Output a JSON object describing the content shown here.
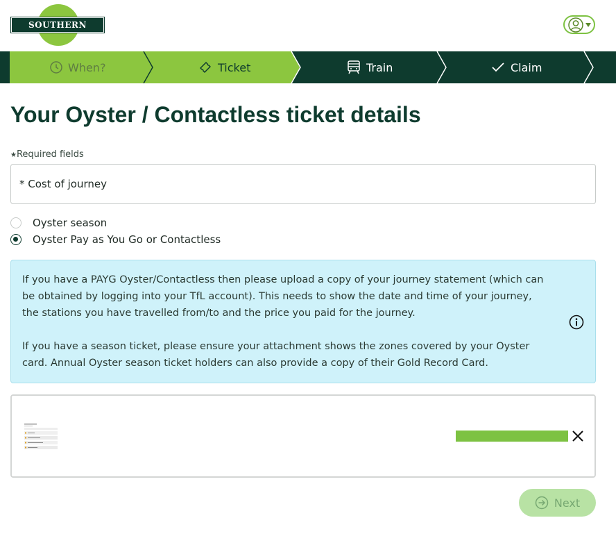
{
  "brand": {
    "logo_text": "SOUTHERN"
  },
  "steps": [
    {
      "label": "When?",
      "icon": "clock-icon",
      "state": "completed"
    },
    {
      "label": "Ticket",
      "icon": "ticket-icon",
      "state": "current"
    },
    {
      "label": "Train",
      "icon": "train-icon",
      "state": "upcoming"
    },
    {
      "label": "Claim",
      "icon": "check-icon",
      "state": "upcoming"
    }
  ],
  "page": {
    "title": "Your Oyster / Contactless ticket details",
    "required_note": "Required fields",
    "required_mark": "★"
  },
  "form": {
    "cost_of_journey": {
      "placeholder": "* Cost of journey",
      "value": ""
    },
    "ticket_type": {
      "options": [
        {
          "label": "Oyster season",
          "checked": false
        },
        {
          "label": "Oyster Pay as You Go or Contactless",
          "checked": true
        }
      ]
    }
  },
  "info": {
    "paragraphs": [
      "If you have a PAYG Oyster/Contactless then please upload a copy of your journey statement (which can be obtained by logging into your TfL account). This needs to show the date and time of your journey, the stations you have travelled from/to and the price you paid for the journey.",
      "If you have a season ticket, please ensure your attachment shows the zones covered by your Oyster card. Annual Oyster season ticket holders can also provide a copy of their Gold Record Card."
    ],
    "icon": "info-icon"
  },
  "upload": {
    "progress": 1.0,
    "remove_icon": "close-icon"
  },
  "actions": {
    "next_label": "Next",
    "next_enabled": false
  },
  "colors": {
    "brand_dark": "#0e3b2e",
    "brand_green": "#8cc63f",
    "info_bg": "#cff2fa",
    "progress": "#7dc242"
  }
}
